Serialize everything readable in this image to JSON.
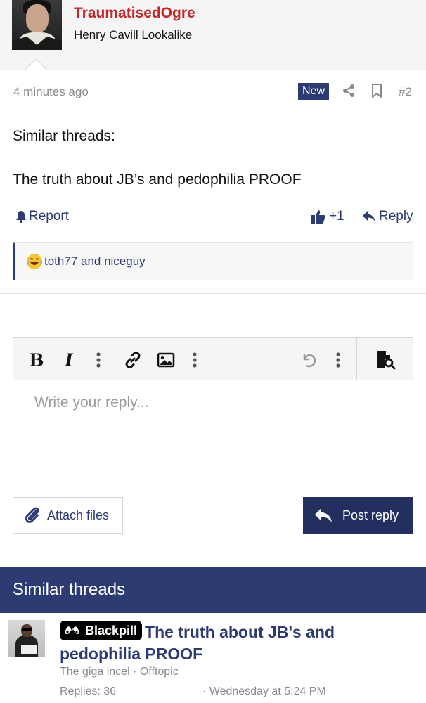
{
  "post": {
    "username": "TraumatisedOgre",
    "user_title": "Henry Cavill Lookalike",
    "time": "4 minutes ago",
    "new_badge": "New",
    "number": "#2",
    "body_line1": "Similar threads:",
    "body_line2": "The truth about JB’s and pedophilia PROOF",
    "report_label": "Report",
    "like_count": "+1",
    "reply_label": "Reply",
    "reactions_text": "toth77 and niceguy"
  },
  "editor": {
    "placeholder": "Write your reply...",
    "toolbar_icons": [
      "bold-icon",
      "italic-icon",
      "more-icon",
      "link-icon",
      "image-icon",
      "more-icon",
      "undo-icon",
      "more-icon",
      "preview-icon"
    ]
  },
  "buttons": {
    "attach_label": "Attach files",
    "post_reply_label": "Post reply"
  },
  "similar_threads": {
    "heading": "Similar threads",
    "items": [
      {
        "prefix": "Blackpill",
        "title": "The truth about JB's and pedophilia PROOF",
        "author": "The giga incel",
        "forum": "Offtopic",
        "replies": "Replies: 36",
        "date": "· Wednesday at 5:24 PM"
      }
    ]
  },
  "colors": {
    "brand": "#2d3b73",
    "username": "#c3262b",
    "muted": "#8a8a8a"
  }
}
